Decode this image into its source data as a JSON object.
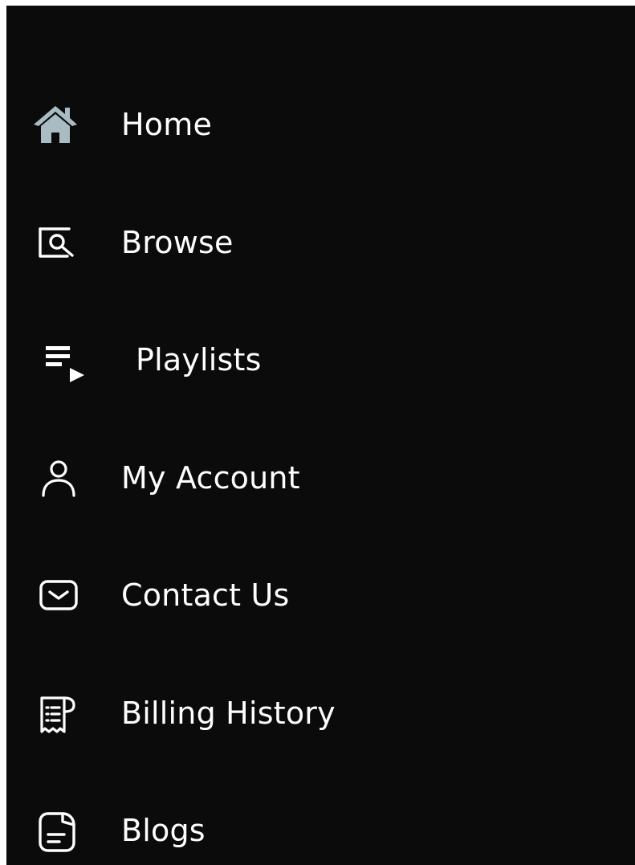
{
  "sidebar": {
    "items": [
      {
        "label": "Home",
        "icon": "home-icon",
        "icon_color": "#a9bcc3"
      },
      {
        "label": "Browse",
        "icon": "browse-icon",
        "icon_color": "#ffffff"
      },
      {
        "label": "Playlists",
        "icon": "playlist-icon",
        "icon_color": "#ffffff"
      },
      {
        "label": "My Account",
        "icon": "user-icon",
        "icon_color": "#ffffff"
      },
      {
        "label": "Contact Us",
        "icon": "mail-icon",
        "icon_color": "#ffffff"
      },
      {
        "label": "Billing History",
        "icon": "receipt-icon",
        "icon_color": "#ffffff"
      },
      {
        "label": "Blogs",
        "icon": "blog-icon",
        "icon_color": "#ffffff"
      }
    ]
  },
  "colors": {
    "background": "#0b0b0c",
    "text": "#ffffff",
    "home_accent": "#a9bcc3"
  }
}
